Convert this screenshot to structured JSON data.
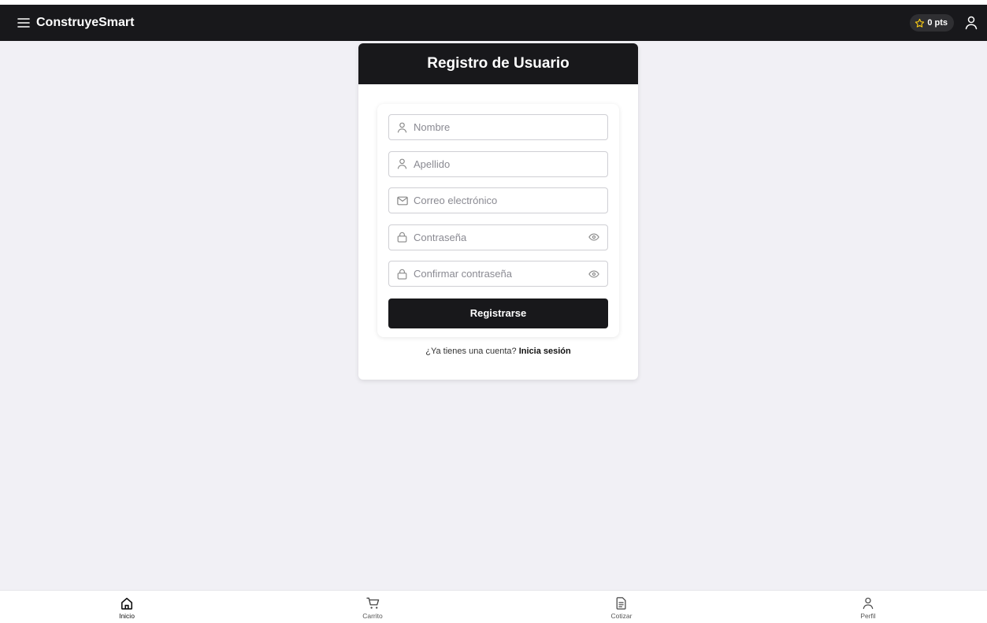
{
  "app": {
    "brand": "ConstruyeSmart",
    "points": "0 pts"
  },
  "register": {
    "title": "Registro de Usuario",
    "fields": {
      "nombre": {
        "placeholder": "Nombre",
        "icon": "user-icon"
      },
      "apellido": {
        "placeholder": "Apellido",
        "icon": "user-icon"
      },
      "email": {
        "placeholder": "Correo electrónico",
        "icon": "mail-icon"
      },
      "password": {
        "placeholder": "Contraseña",
        "icon": "lock-icon"
      },
      "confirm": {
        "placeholder": "Confirmar contraseña",
        "icon": "lock-icon"
      }
    },
    "submit_label": "Registrarse",
    "login_prompt": "¿Ya tienes una cuenta?",
    "login_link": "Inicia sesión"
  },
  "bottom_nav": [
    {
      "label": "Inicio",
      "icon": "home-icon",
      "active": true
    },
    {
      "label": "Carrito",
      "icon": "cart-icon",
      "active": false
    },
    {
      "label": "Cotizar",
      "icon": "document-icon",
      "active": false
    },
    {
      "label": "Perfil",
      "icon": "user-icon",
      "active": false
    }
  ],
  "colors": {
    "dark": "#18181b",
    "background": "#f1f0f5",
    "star": "#facc15"
  }
}
